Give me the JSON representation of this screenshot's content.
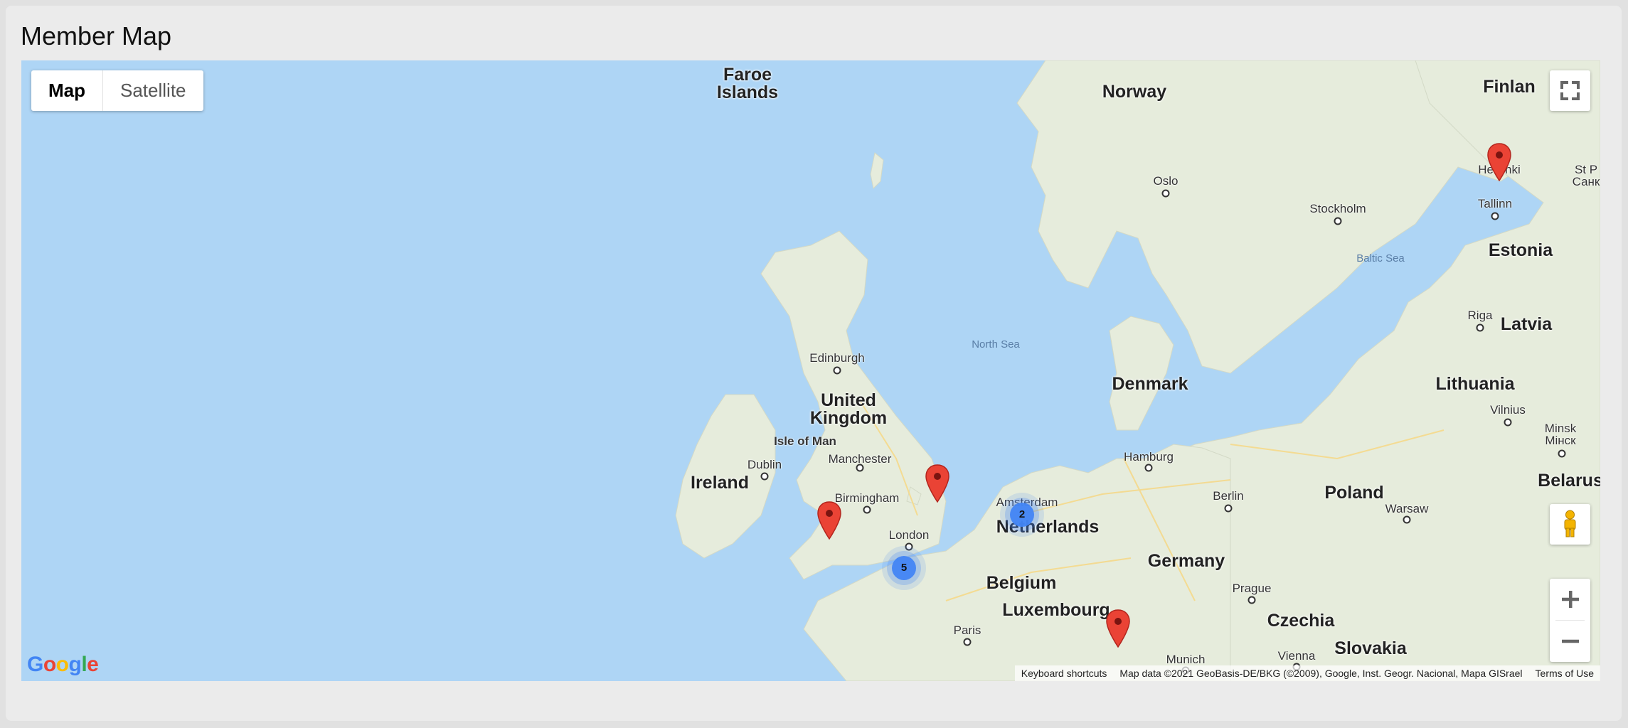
{
  "page": {
    "title": "Member Map"
  },
  "map_type": {
    "map_label": "Map",
    "satellite_label": "Satellite",
    "selected": "Map"
  },
  "labels": {
    "faroe_1": "Faroe",
    "faroe_2": "Islands",
    "norway": "Norway",
    "finland": "Finlan",
    "oslo": "Oslo",
    "stockholm": "Stockholm",
    "helsinki": "Helsinki",
    "st_p_1": "St P",
    "st_p_2": "Санк",
    "tallinn": "Tallinn",
    "estonia": "Estonia",
    "baltic_sea": "Baltic Sea",
    "riga": "Riga",
    "latvia": "Latvia",
    "north_sea": "North Sea",
    "edinburgh": "Edinburgh",
    "uk_1": "United",
    "uk_2": "Kingdom",
    "denmark": "Denmark",
    "lithuania": "Lithuania",
    "vilnius": "Vilnius",
    "minsk_1": "Minsk",
    "minsk_2": "Мінск",
    "belarus": "Belarus",
    "isle_of_man": "Isle of Man",
    "manchester": "Manchester",
    "hamburg": "Hamburg",
    "dublin": "Dublin",
    "ireland": "Ireland",
    "birmingham": "Birmingham",
    "amsterdam": "Amsterdam",
    "berlin": "Berlin",
    "poland": "Poland",
    "warsaw": "Warsaw",
    "netherlands": "Netherlands",
    "london": "London",
    "germany": "Germany",
    "belgium": "Belgium",
    "prague": "Prague",
    "luxembourg": "Luxembourg",
    "czechia": "Czechia",
    "paris": "Paris",
    "slovakia": "Slovakia",
    "vienna": "Vienna",
    "munich": "Munich"
  },
  "markers": {
    "clusters": [
      {
        "name": "london-cluster",
        "count": "5"
      },
      {
        "name": "amsterdam-cluster",
        "count": "2"
      }
    ],
    "pins": [
      "helsinki",
      "wales",
      "east-england",
      "southern-germany"
    ]
  },
  "controls": {
    "fullscreen_icon": "fullscreen-icon",
    "pegman_icon": "pegman-icon",
    "zoom_in_icon": "plus-icon",
    "zoom_out_icon": "minus-icon"
  },
  "footer": {
    "logo": "Google",
    "keyboard_shortcuts": "Keyboard shortcuts",
    "map_data": "Map data ©2021 GeoBasis-DE/BKG (©2009), Google, Inst. Geogr. Nacional, Mapa GISrael",
    "terms": "Terms of Use"
  },
  "colors": {
    "water": "#aed5f5",
    "land": "#e8ecdf",
    "pin": "#ea4335",
    "cluster": "#4285f4"
  }
}
